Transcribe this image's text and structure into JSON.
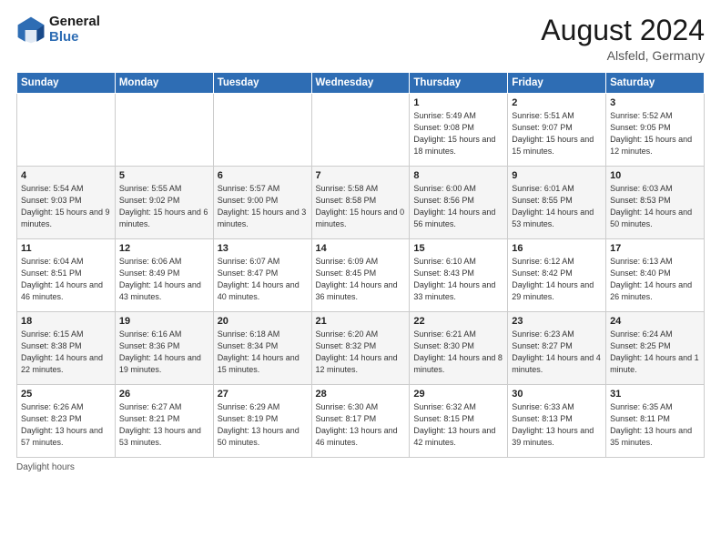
{
  "header": {
    "logo_line1": "General",
    "logo_line2": "Blue",
    "month_year": "August 2024",
    "location": "Alsfeld, Germany"
  },
  "days_of_week": [
    "Sunday",
    "Monday",
    "Tuesday",
    "Wednesday",
    "Thursday",
    "Friday",
    "Saturday"
  ],
  "weeks": [
    [
      {
        "day": "",
        "sunrise": "",
        "sunset": "",
        "daylight": ""
      },
      {
        "day": "",
        "sunrise": "",
        "sunset": "",
        "daylight": ""
      },
      {
        "day": "",
        "sunrise": "",
        "sunset": "",
        "daylight": ""
      },
      {
        "day": "",
        "sunrise": "",
        "sunset": "",
        "daylight": ""
      },
      {
        "day": "1",
        "sunrise": "Sunrise: 5:49 AM",
        "sunset": "Sunset: 9:08 PM",
        "daylight": "Daylight: 15 hours and 18 minutes."
      },
      {
        "day": "2",
        "sunrise": "Sunrise: 5:51 AM",
        "sunset": "Sunset: 9:07 PM",
        "daylight": "Daylight: 15 hours and 15 minutes."
      },
      {
        "day": "3",
        "sunrise": "Sunrise: 5:52 AM",
        "sunset": "Sunset: 9:05 PM",
        "daylight": "Daylight: 15 hours and 12 minutes."
      }
    ],
    [
      {
        "day": "4",
        "sunrise": "Sunrise: 5:54 AM",
        "sunset": "Sunset: 9:03 PM",
        "daylight": "Daylight: 15 hours and 9 minutes."
      },
      {
        "day": "5",
        "sunrise": "Sunrise: 5:55 AM",
        "sunset": "Sunset: 9:02 PM",
        "daylight": "Daylight: 15 hours and 6 minutes."
      },
      {
        "day": "6",
        "sunrise": "Sunrise: 5:57 AM",
        "sunset": "Sunset: 9:00 PM",
        "daylight": "Daylight: 15 hours and 3 minutes."
      },
      {
        "day": "7",
        "sunrise": "Sunrise: 5:58 AM",
        "sunset": "Sunset: 8:58 PM",
        "daylight": "Daylight: 15 hours and 0 minutes."
      },
      {
        "day": "8",
        "sunrise": "Sunrise: 6:00 AM",
        "sunset": "Sunset: 8:56 PM",
        "daylight": "Daylight: 14 hours and 56 minutes."
      },
      {
        "day": "9",
        "sunrise": "Sunrise: 6:01 AM",
        "sunset": "Sunset: 8:55 PM",
        "daylight": "Daylight: 14 hours and 53 minutes."
      },
      {
        "day": "10",
        "sunrise": "Sunrise: 6:03 AM",
        "sunset": "Sunset: 8:53 PM",
        "daylight": "Daylight: 14 hours and 50 minutes."
      }
    ],
    [
      {
        "day": "11",
        "sunrise": "Sunrise: 6:04 AM",
        "sunset": "Sunset: 8:51 PM",
        "daylight": "Daylight: 14 hours and 46 minutes."
      },
      {
        "day": "12",
        "sunrise": "Sunrise: 6:06 AM",
        "sunset": "Sunset: 8:49 PM",
        "daylight": "Daylight: 14 hours and 43 minutes."
      },
      {
        "day": "13",
        "sunrise": "Sunrise: 6:07 AM",
        "sunset": "Sunset: 8:47 PM",
        "daylight": "Daylight: 14 hours and 40 minutes."
      },
      {
        "day": "14",
        "sunrise": "Sunrise: 6:09 AM",
        "sunset": "Sunset: 8:45 PM",
        "daylight": "Daylight: 14 hours and 36 minutes."
      },
      {
        "day": "15",
        "sunrise": "Sunrise: 6:10 AM",
        "sunset": "Sunset: 8:43 PM",
        "daylight": "Daylight: 14 hours and 33 minutes."
      },
      {
        "day": "16",
        "sunrise": "Sunrise: 6:12 AM",
        "sunset": "Sunset: 8:42 PM",
        "daylight": "Daylight: 14 hours and 29 minutes."
      },
      {
        "day": "17",
        "sunrise": "Sunrise: 6:13 AM",
        "sunset": "Sunset: 8:40 PM",
        "daylight": "Daylight: 14 hours and 26 minutes."
      }
    ],
    [
      {
        "day": "18",
        "sunrise": "Sunrise: 6:15 AM",
        "sunset": "Sunset: 8:38 PM",
        "daylight": "Daylight: 14 hours and 22 minutes."
      },
      {
        "day": "19",
        "sunrise": "Sunrise: 6:16 AM",
        "sunset": "Sunset: 8:36 PM",
        "daylight": "Daylight: 14 hours and 19 minutes."
      },
      {
        "day": "20",
        "sunrise": "Sunrise: 6:18 AM",
        "sunset": "Sunset: 8:34 PM",
        "daylight": "Daylight: 14 hours and 15 minutes."
      },
      {
        "day": "21",
        "sunrise": "Sunrise: 6:20 AM",
        "sunset": "Sunset: 8:32 PM",
        "daylight": "Daylight: 14 hours and 12 minutes."
      },
      {
        "day": "22",
        "sunrise": "Sunrise: 6:21 AM",
        "sunset": "Sunset: 8:30 PM",
        "daylight": "Daylight: 14 hours and 8 minutes."
      },
      {
        "day": "23",
        "sunrise": "Sunrise: 6:23 AM",
        "sunset": "Sunset: 8:27 PM",
        "daylight": "Daylight: 14 hours and 4 minutes."
      },
      {
        "day": "24",
        "sunrise": "Sunrise: 6:24 AM",
        "sunset": "Sunset: 8:25 PM",
        "daylight": "Daylight: 14 hours and 1 minute."
      }
    ],
    [
      {
        "day": "25",
        "sunrise": "Sunrise: 6:26 AM",
        "sunset": "Sunset: 8:23 PM",
        "daylight": "Daylight: 13 hours and 57 minutes."
      },
      {
        "day": "26",
        "sunrise": "Sunrise: 6:27 AM",
        "sunset": "Sunset: 8:21 PM",
        "daylight": "Daylight: 13 hours and 53 minutes."
      },
      {
        "day": "27",
        "sunrise": "Sunrise: 6:29 AM",
        "sunset": "Sunset: 8:19 PM",
        "daylight": "Daylight: 13 hours and 50 minutes."
      },
      {
        "day": "28",
        "sunrise": "Sunrise: 6:30 AM",
        "sunset": "Sunset: 8:17 PM",
        "daylight": "Daylight: 13 hours and 46 minutes."
      },
      {
        "day": "29",
        "sunrise": "Sunrise: 6:32 AM",
        "sunset": "Sunset: 8:15 PM",
        "daylight": "Daylight: 13 hours and 42 minutes."
      },
      {
        "day": "30",
        "sunrise": "Sunrise: 6:33 AM",
        "sunset": "Sunset: 8:13 PM",
        "daylight": "Daylight: 13 hours and 39 minutes."
      },
      {
        "day": "31",
        "sunrise": "Sunrise: 6:35 AM",
        "sunset": "Sunset: 8:11 PM",
        "daylight": "Daylight: 13 hours and 35 minutes."
      }
    ]
  ],
  "footer": {
    "note": "Daylight hours"
  }
}
